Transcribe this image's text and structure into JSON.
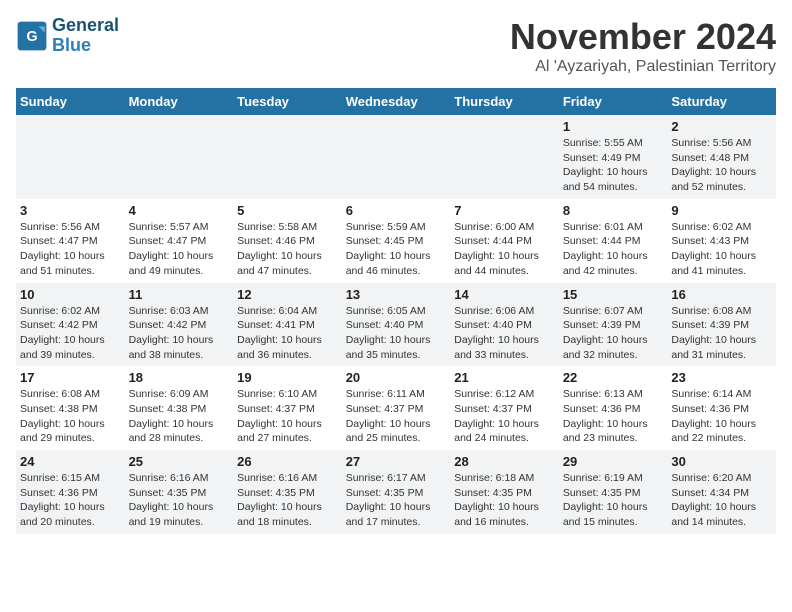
{
  "logo": {
    "line1": "General",
    "line2": "Blue"
  },
  "title": "November 2024",
  "location": "Al 'Ayzariyah, Palestinian Territory",
  "header": {
    "days": [
      "Sunday",
      "Monday",
      "Tuesday",
      "Wednesday",
      "Thursday",
      "Friday",
      "Saturday"
    ]
  },
  "weeks": [
    {
      "cells": [
        {
          "day": null,
          "info": null
        },
        {
          "day": null,
          "info": null
        },
        {
          "day": null,
          "info": null
        },
        {
          "day": null,
          "info": null
        },
        {
          "day": null,
          "info": null
        },
        {
          "day": "1",
          "info": "Sunrise: 5:55 AM\nSunset: 4:49 PM\nDaylight: 10 hours\nand 54 minutes."
        },
        {
          "day": "2",
          "info": "Sunrise: 5:56 AM\nSunset: 4:48 PM\nDaylight: 10 hours\nand 52 minutes."
        }
      ]
    },
    {
      "cells": [
        {
          "day": "3",
          "info": "Sunrise: 5:56 AM\nSunset: 4:47 PM\nDaylight: 10 hours\nand 51 minutes."
        },
        {
          "day": "4",
          "info": "Sunrise: 5:57 AM\nSunset: 4:47 PM\nDaylight: 10 hours\nand 49 minutes."
        },
        {
          "day": "5",
          "info": "Sunrise: 5:58 AM\nSunset: 4:46 PM\nDaylight: 10 hours\nand 47 minutes."
        },
        {
          "day": "6",
          "info": "Sunrise: 5:59 AM\nSunset: 4:45 PM\nDaylight: 10 hours\nand 46 minutes."
        },
        {
          "day": "7",
          "info": "Sunrise: 6:00 AM\nSunset: 4:44 PM\nDaylight: 10 hours\nand 44 minutes."
        },
        {
          "day": "8",
          "info": "Sunrise: 6:01 AM\nSunset: 4:44 PM\nDaylight: 10 hours\nand 42 minutes."
        },
        {
          "day": "9",
          "info": "Sunrise: 6:02 AM\nSunset: 4:43 PM\nDaylight: 10 hours\nand 41 minutes."
        }
      ]
    },
    {
      "cells": [
        {
          "day": "10",
          "info": "Sunrise: 6:02 AM\nSunset: 4:42 PM\nDaylight: 10 hours\nand 39 minutes."
        },
        {
          "day": "11",
          "info": "Sunrise: 6:03 AM\nSunset: 4:42 PM\nDaylight: 10 hours\nand 38 minutes."
        },
        {
          "day": "12",
          "info": "Sunrise: 6:04 AM\nSunset: 4:41 PM\nDaylight: 10 hours\nand 36 minutes."
        },
        {
          "day": "13",
          "info": "Sunrise: 6:05 AM\nSunset: 4:40 PM\nDaylight: 10 hours\nand 35 minutes."
        },
        {
          "day": "14",
          "info": "Sunrise: 6:06 AM\nSunset: 4:40 PM\nDaylight: 10 hours\nand 33 minutes."
        },
        {
          "day": "15",
          "info": "Sunrise: 6:07 AM\nSunset: 4:39 PM\nDaylight: 10 hours\nand 32 minutes."
        },
        {
          "day": "16",
          "info": "Sunrise: 6:08 AM\nSunset: 4:39 PM\nDaylight: 10 hours\nand 31 minutes."
        }
      ]
    },
    {
      "cells": [
        {
          "day": "17",
          "info": "Sunrise: 6:08 AM\nSunset: 4:38 PM\nDaylight: 10 hours\nand 29 minutes."
        },
        {
          "day": "18",
          "info": "Sunrise: 6:09 AM\nSunset: 4:38 PM\nDaylight: 10 hours\nand 28 minutes."
        },
        {
          "day": "19",
          "info": "Sunrise: 6:10 AM\nSunset: 4:37 PM\nDaylight: 10 hours\nand 27 minutes."
        },
        {
          "day": "20",
          "info": "Sunrise: 6:11 AM\nSunset: 4:37 PM\nDaylight: 10 hours\nand 25 minutes."
        },
        {
          "day": "21",
          "info": "Sunrise: 6:12 AM\nSunset: 4:37 PM\nDaylight: 10 hours\nand 24 minutes."
        },
        {
          "day": "22",
          "info": "Sunrise: 6:13 AM\nSunset: 4:36 PM\nDaylight: 10 hours\nand 23 minutes."
        },
        {
          "day": "23",
          "info": "Sunrise: 6:14 AM\nSunset: 4:36 PM\nDaylight: 10 hours\nand 22 minutes."
        }
      ]
    },
    {
      "cells": [
        {
          "day": "24",
          "info": "Sunrise: 6:15 AM\nSunset: 4:36 PM\nDaylight: 10 hours\nand 20 minutes."
        },
        {
          "day": "25",
          "info": "Sunrise: 6:16 AM\nSunset: 4:35 PM\nDaylight: 10 hours\nand 19 minutes."
        },
        {
          "day": "26",
          "info": "Sunrise: 6:16 AM\nSunset: 4:35 PM\nDaylight: 10 hours\nand 18 minutes."
        },
        {
          "day": "27",
          "info": "Sunrise: 6:17 AM\nSunset: 4:35 PM\nDaylight: 10 hours\nand 17 minutes."
        },
        {
          "day": "28",
          "info": "Sunrise: 6:18 AM\nSunset: 4:35 PM\nDaylight: 10 hours\nand 16 minutes."
        },
        {
          "day": "29",
          "info": "Sunrise: 6:19 AM\nSunset: 4:35 PM\nDaylight: 10 hours\nand 15 minutes."
        },
        {
          "day": "30",
          "info": "Sunrise: 6:20 AM\nSunset: 4:34 PM\nDaylight: 10 hours\nand 14 minutes."
        }
      ]
    }
  ]
}
